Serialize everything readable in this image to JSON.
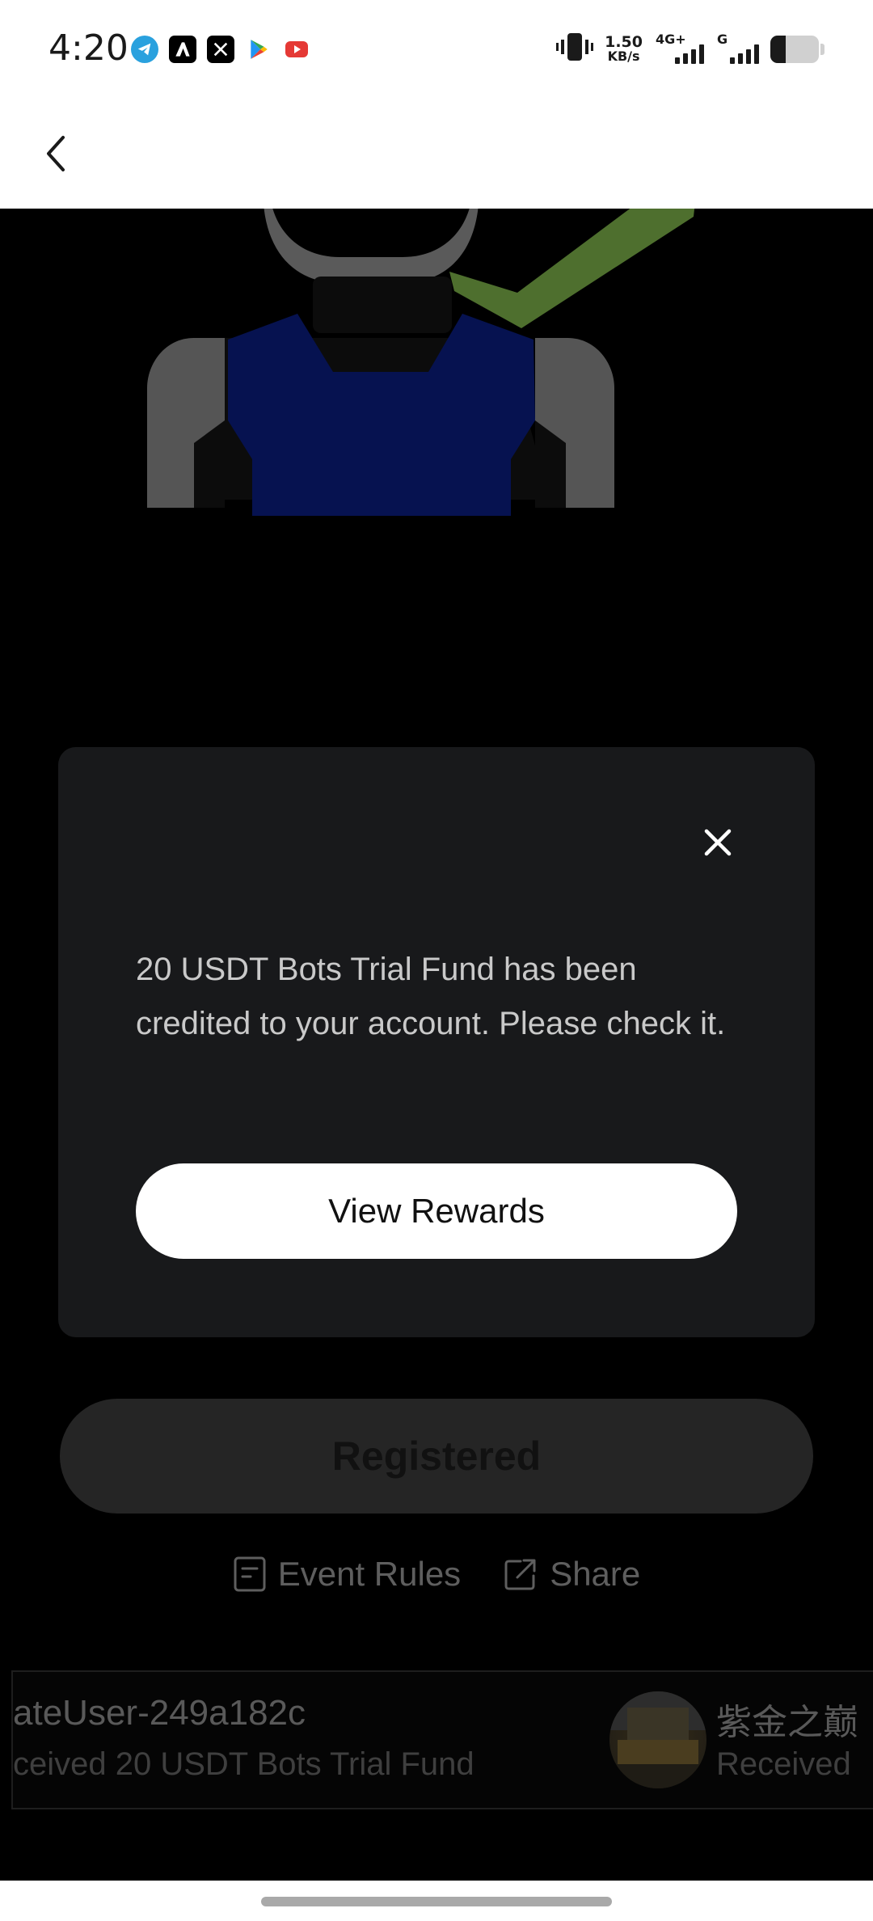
{
  "status_bar": {
    "time": "4:20",
    "notification_icons": [
      "telegram-icon",
      "app-icon",
      "x-icon",
      "play-store-icon",
      "youtube-icon"
    ],
    "net_speed_value": "1.50",
    "net_speed_unit": "KB/s",
    "sim1_label": "4G+",
    "sim2_label": "G",
    "battery_level": 0.32
  },
  "app_bar": {
    "back_icon": "back-arrow-icon"
  },
  "modal": {
    "message": "20 USDT Bots Trial Fund has been credited to your account. Please check it.",
    "button_label": "View Rewards",
    "close_icon": "close-icon"
  },
  "page": {
    "register_button_label": "Registered",
    "event_rules_label": "Event Rules",
    "share_label": "Share",
    "ticker": [
      {
        "name": "ateUser-249a182c",
        "desc": "ceived 20 USDT Bots Trial Fund"
      },
      {
        "name": "紫金之巅",
        "desc": "Received"
      }
    ]
  },
  "colors": {
    "modal_bg": "#18191b",
    "accent_green": "#4e6f2e",
    "vest_blue": "#061250"
  }
}
